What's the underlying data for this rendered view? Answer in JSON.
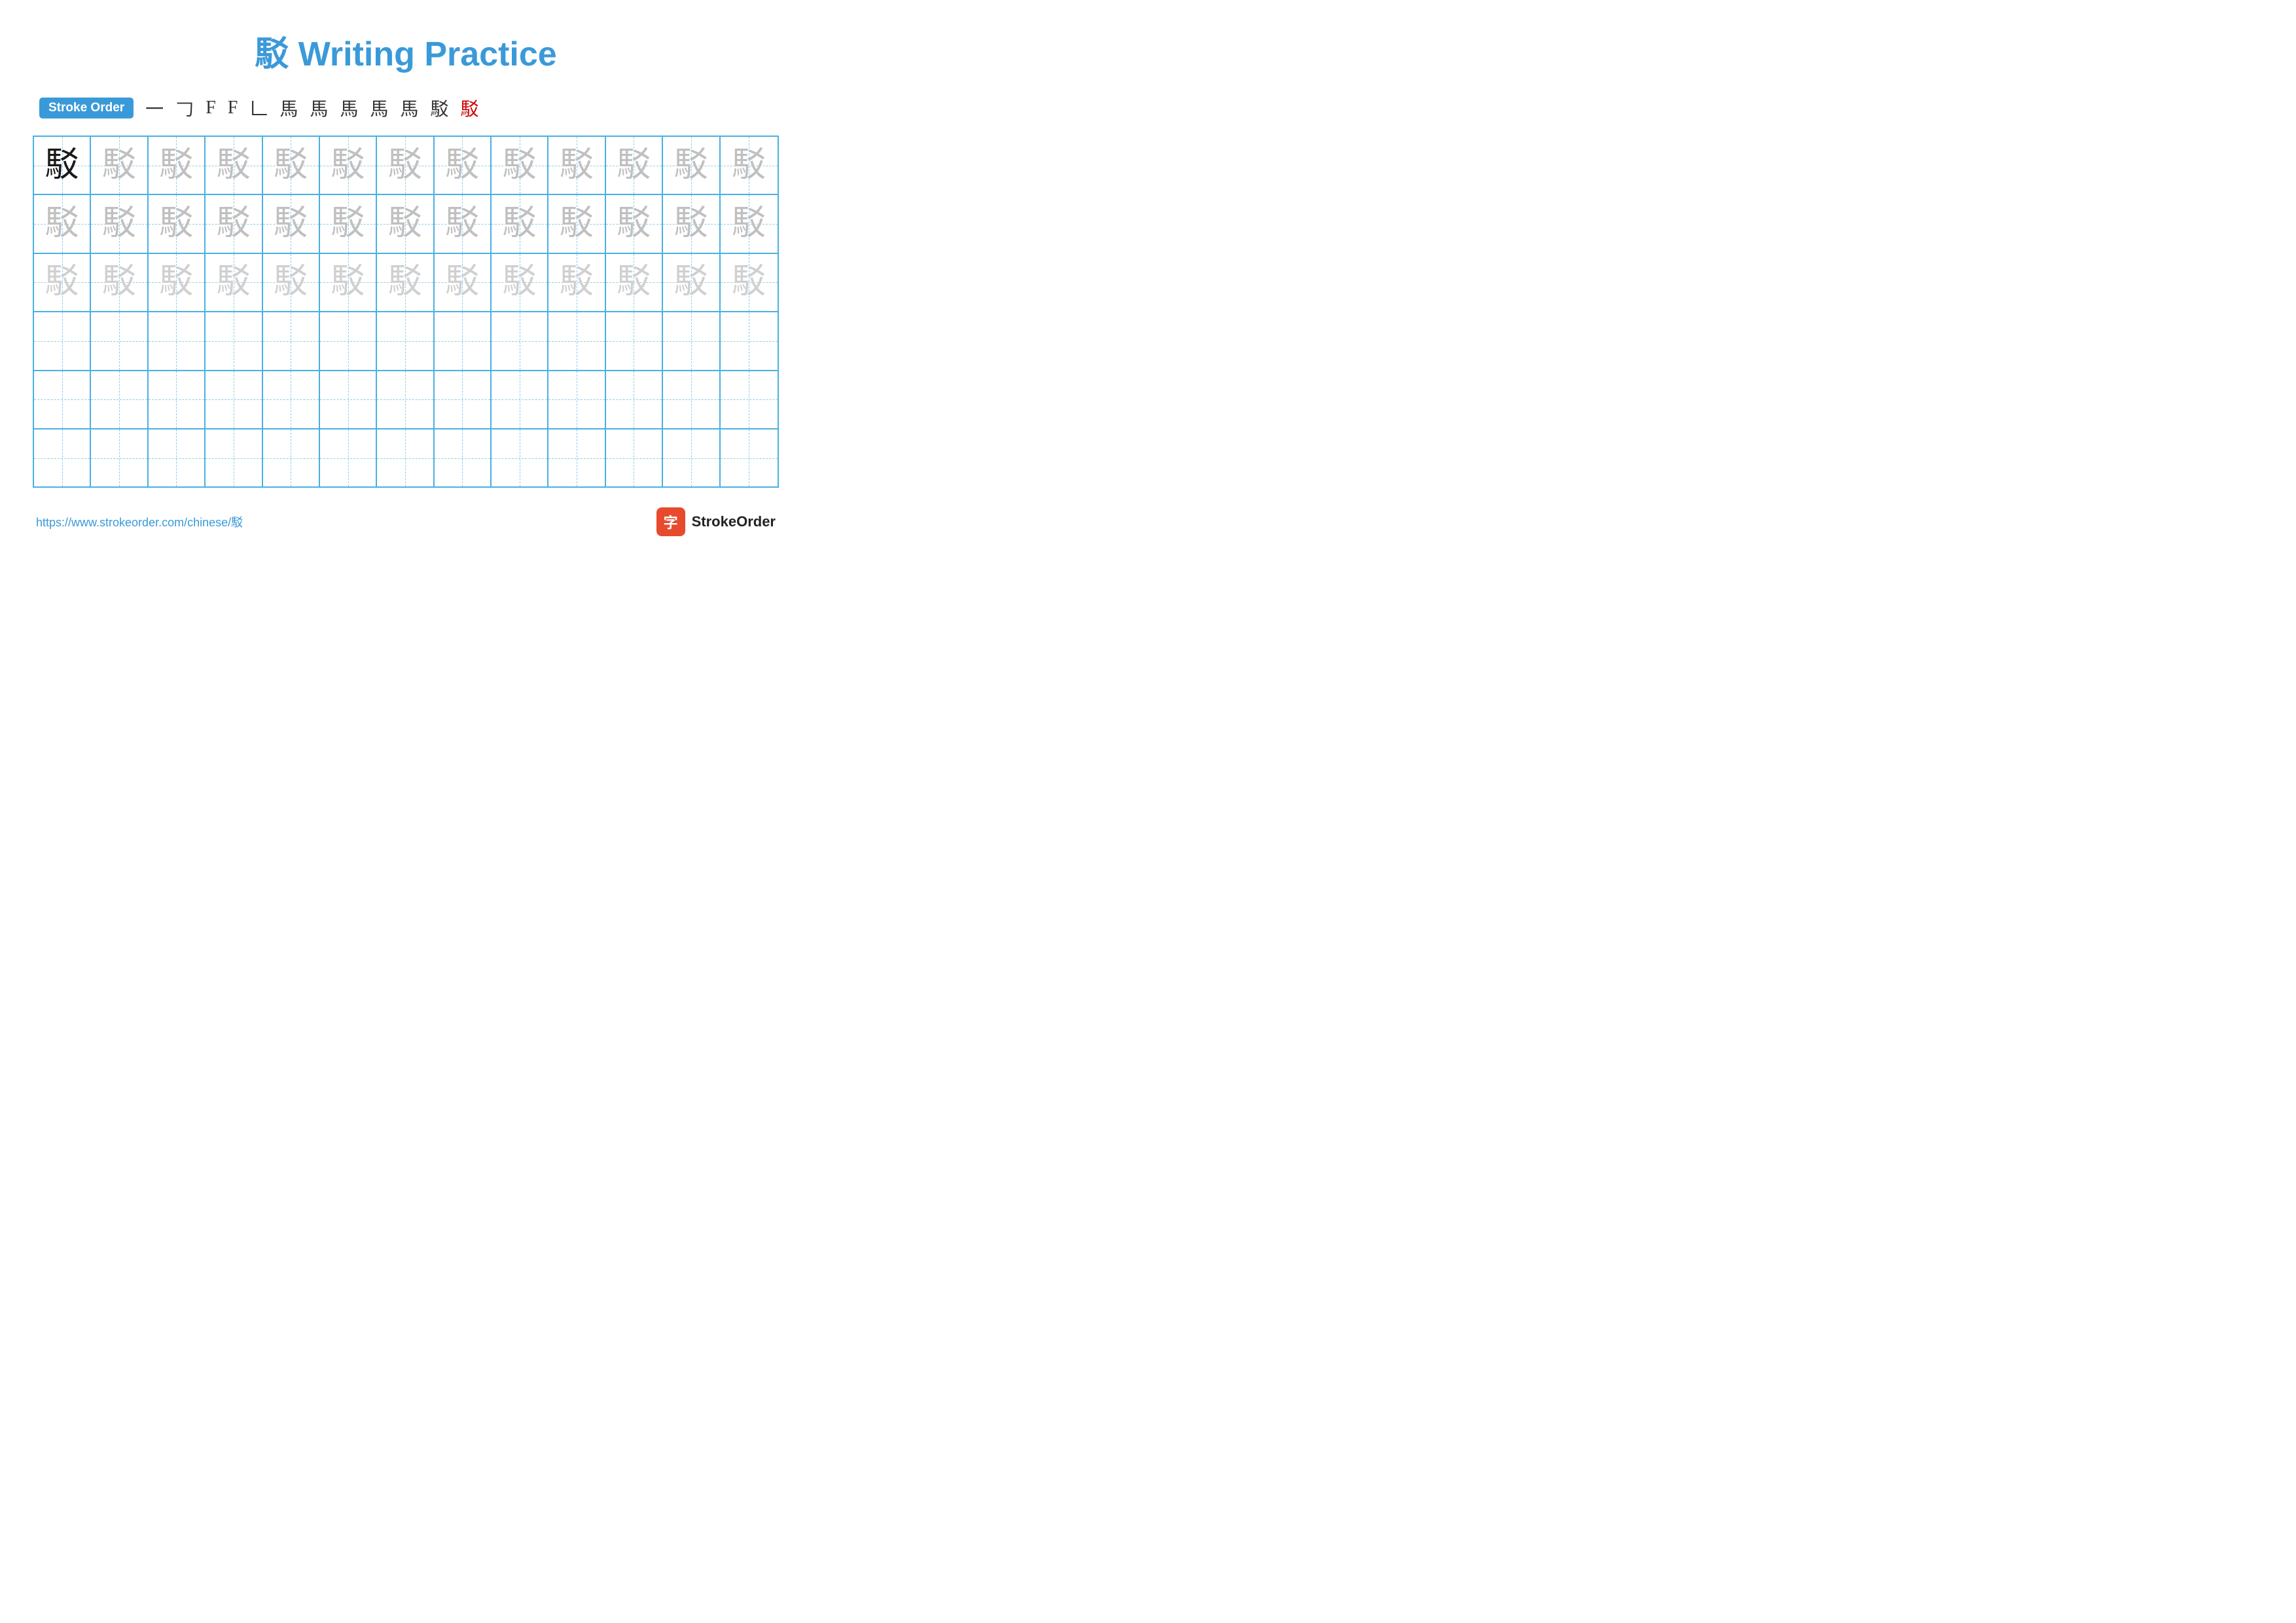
{
  "title": "駁 Writing Practice",
  "stroke_order": {
    "label": "Stroke Order",
    "steps": [
      "一",
      "𠃌",
      "F",
      "F",
      "𠃊",
      "馬",
      "馬",
      "馬",
      "馬",
      "馬",
      "駁",
      "駁"
    ]
  },
  "character": "駁",
  "grid": {
    "rows": 6,
    "cols": 13,
    "row_types": [
      "dark_then_light1",
      "light1",
      "light2",
      "empty",
      "empty",
      "empty"
    ]
  },
  "footer": {
    "link_text": "https://www.strokeorder.com/chinese/駁",
    "brand_icon": "字",
    "brand_name": "StrokeOrder"
  }
}
